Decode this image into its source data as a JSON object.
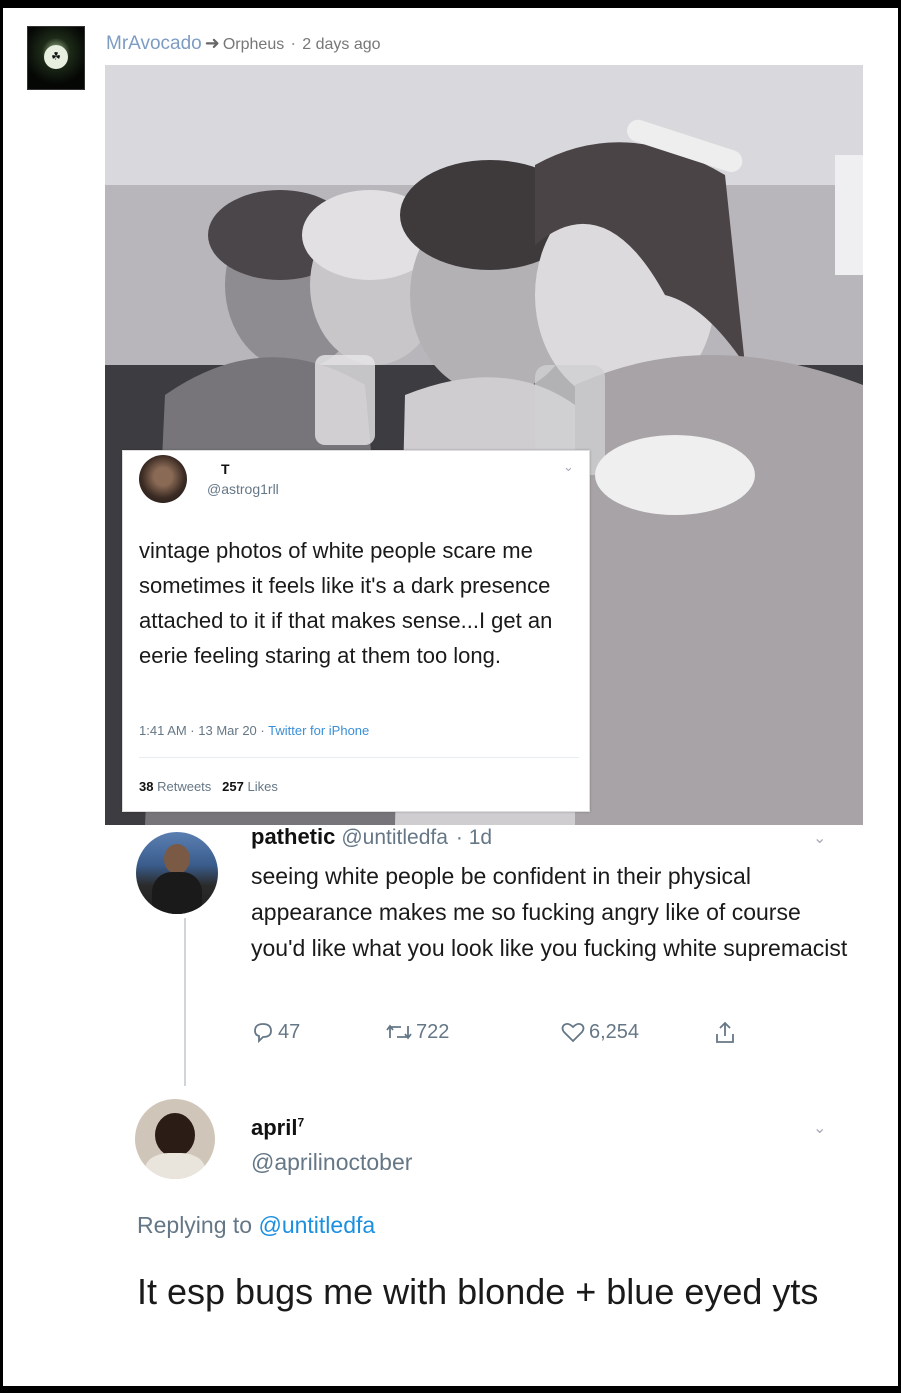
{
  "post": {
    "author": "MrAvocado",
    "target": "Orpheus",
    "time": "2 days ago"
  },
  "embedded_tweet": {
    "name": "T",
    "handle": "@astrog1rll",
    "text": "vintage photos of white people scare me sometimes it feels like it's a dark presence attached to it if that makes sense...I get an eerie feeling staring at them too long.",
    "timestamp": "1:41 AM · 13 Mar 20 · ",
    "source": "Twitter for iPhone",
    "retweets_count": "38",
    "retweets_label": "Retweets",
    "likes_count": "257",
    "likes_label": "Likes"
  },
  "reply1": {
    "name": "pathetic",
    "handle": "@untitledfa",
    "time": "· 1d",
    "text": "seeing white people be confident in their physical appearance makes me so fucking angry like of course you'd like what you look like you fucking white supremacist",
    "replies": "47",
    "retweets": "722",
    "likes": "6,254"
  },
  "reply2": {
    "name": "april",
    "name_sup": "7",
    "handle": "@aprilinoctober",
    "replying_prefix": "Replying to ",
    "replying_to": "@untitledfa",
    "text": "It esp bugs me with blonde + blue eyed yts"
  },
  "colors": {
    "link": "#1b8fe0",
    "muted": "#657786",
    "author": "#7d9cc4"
  }
}
